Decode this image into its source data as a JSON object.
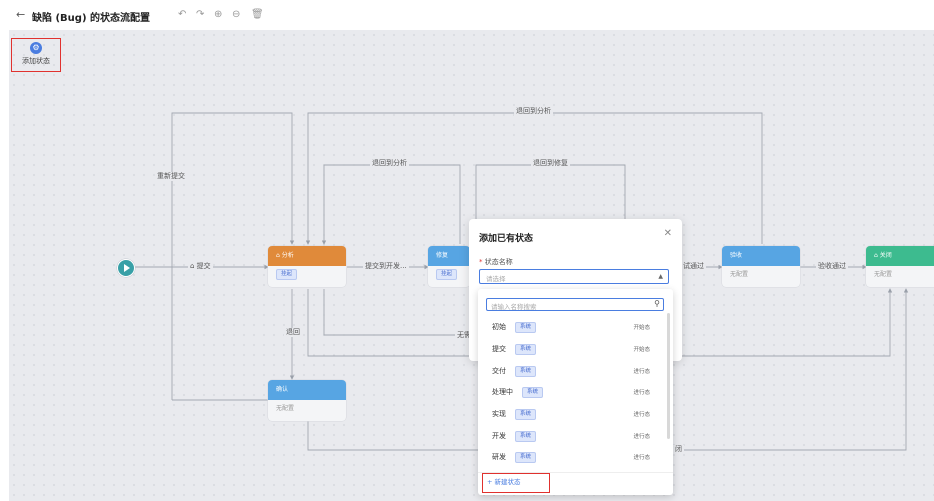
{
  "header": {
    "back_icon": "arrow-left-icon",
    "title": "缺陷 (Bug) 的状态流配置",
    "toolbar_icons": [
      "undo-icon",
      "redo-icon",
      "zoom-in-icon",
      "zoom-out-icon",
      "delete-icon"
    ]
  },
  "add_state": {
    "label": "添加状态",
    "icon": "gear-icon"
  },
  "colors": {
    "accent": "#4a7de0",
    "orange": "#e08a3a",
    "blue": "#57a5e3",
    "green": "#3dbb8f",
    "highlight": "#e0312e"
  },
  "nodes": {
    "analyze": {
      "title": "分析",
      "tag": "挂起"
    },
    "fix": {
      "title": "修复",
      "tag": "挂起"
    },
    "confirm": {
      "title": "确认",
      "body": "无配置"
    },
    "accept": {
      "title": "验收",
      "body": "无配置"
    },
    "close": {
      "title": "关闭",
      "body": "无配置"
    }
  },
  "edges": {
    "submit": "提交",
    "resubmit": "重新提交",
    "back_to_analyze_top": "退回到分析",
    "back_to_analyze": "退回到分析",
    "back_to_fix": "退回到修复",
    "submit_to_dev": "提交到开发...",
    "test_pass": "试通过",
    "accept_pass": "验收通过",
    "return": "退回",
    "no_fix": "无需",
    "close_partial": "闭"
  },
  "modal": {
    "title": "添加已有状态",
    "field_label": "状态名称",
    "select_placeholder": "请选择",
    "close_icon": "close-icon"
  },
  "dropdown": {
    "search_placeholder": "请输入名称搜索",
    "options": [
      {
        "name": "初始",
        "tag": "系统",
        "status": "开始态"
      },
      {
        "name": "提交",
        "tag": "系统",
        "status": "开始态"
      },
      {
        "name": "交付",
        "tag": "系统",
        "status": "进行态"
      },
      {
        "name": "处理中",
        "tag": "系统",
        "status": "进行态"
      },
      {
        "name": "实现",
        "tag": "系统",
        "status": "进行态"
      },
      {
        "name": "开发",
        "tag": "系统",
        "status": "进行态"
      },
      {
        "name": "研发",
        "tag": "系统",
        "status": "进行态"
      }
    ],
    "new_state": "+ 新建状态"
  }
}
